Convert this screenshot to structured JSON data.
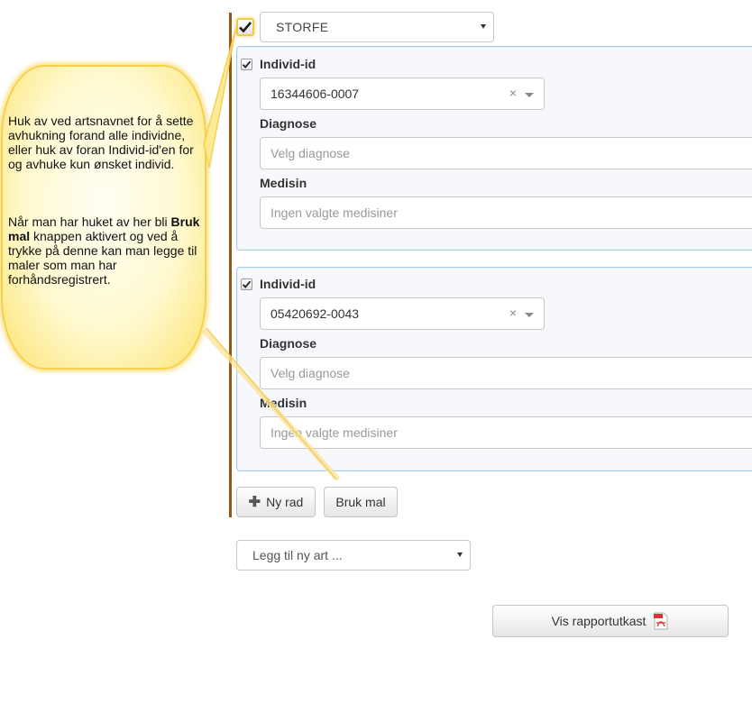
{
  "callout": {
    "paragraph1": "Huk av ved artsnavnet for å sette avhukning forand alle individne, eller huk av foran Individ-id'en for og avhuke kun ønsket individ.",
    "paragraph2_pre": "Når man har huket av her bli ",
    "paragraph2_bold": "Bruk mal",
    "paragraph2_post": " knappen aktivert og ved å trykke på denne kan man legge til maler som man har forhåndsregistrert."
  },
  "species": {
    "selected": "STORFE"
  },
  "individuals": [
    {
      "id_label": "Individ-id",
      "id_value": "16344606-0007",
      "diagnosis_label": "Diagnose",
      "diagnosis_placeholder": "Velg diagnose",
      "medicine_label": "Medisin",
      "medicine_placeholder": "Ingen valgte medisiner"
    },
    {
      "id_label": "Individ-id",
      "id_value": "05420692-0043",
      "diagnosis_label": "Diagnose",
      "diagnosis_placeholder": "Velg diagnose",
      "medicine_label": "Medisin",
      "medicine_placeholder": "Ingen valgte medisiner"
    }
  ],
  "buttons": {
    "new_row": "Ny rad",
    "use_template": "Bruk mal",
    "show_report": "Vis rapportutkast"
  },
  "add_species": {
    "placeholder": "Legg til ny art ..."
  },
  "icons": {
    "clear": "×",
    "plus": "✚"
  },
  "colors": {
    "accent_bar": "#8a5a14",
    "panel_border": "#a8cdea",
    "callout_border": "#f6d04c"
  }
}
